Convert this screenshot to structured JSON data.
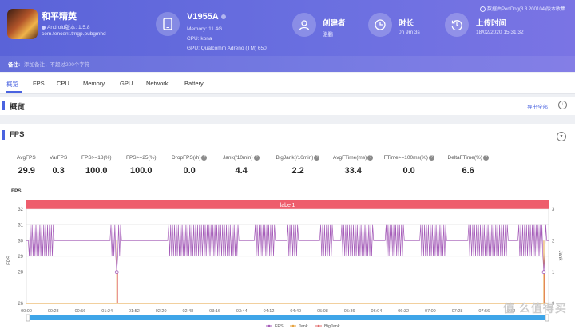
{
  "app": {
    "name": "和平精英",
    "os": "Android版本: 1.5.8",
    "package": "com.tencent.tmgp.pubgmhd"
  },
  "device": {
    "name": "V1955A",
    "memory": "Memory: 11.4G",
    "cpu": "CPU: kona",
    "gpu": "GPU: Qualcomm Adreno (TM) 650"
  },
  "creator": {
    "title": "创建者",
    "value": "骆鹏"
  },
  "duration": {
    "title": "时长",
    "value": "0h 9m 3s"
  },
  "upload": {
    "title": "上传时间",
    "value": "18/02/2020 15:31:32"
  },
  "perfdog": "数据由PerfDog(3.3.200104)版本收集",
  "note": {
    "label": "备注:",
    "placeholder": "添加备注，不超过200个字符"
  },
  "tabs": [
    "概览",
    "FPS",
    "CPU",
    "Memory",
    "GPU",
    "Network",
    "Battery"
  ],
  "overview": {
    "title": "概览",
    "export": "导出全部"
  },
  "fps_panel": {
    "title": "FPS"
  },
  "stats": [
    {
      "label": "AvgFPS",
      "value": "29.9",
      "help": false
    },
    {
      "label": "VarFPS",
      "value": "0.3",
      "help": false
    },
    {
      "label": "FPS>=18(%)",
      "value": "100.0",
      "help": false
    },
    {
      "label": "FPS>=25(%)",
      "value": "100.0",
      "help": false
    },
    {
      "label": "DropFPS(/h)",
      "value": "0.0",
      "help": true
    },
    {
      "label": "Jank(/10min)",
      "value": "4.4",
      "help": true
    },
    {
      "label": "BigJank(/10min)",
      "value": "2.2",
      "help": true
    },
    {
      "label": "AvgFTime(ms)",
      "value": "33.4",
      "help": true
    },
    {
      "label": "FTime>=100ms(%)",
      "value": "0.0",
      "help": true
    },
    {
      "label": "DeltaFTime(%)",
      "value": "6.6",
      "help": true
    }
  ],
  "watermark": "值 么值得买",
  "chart_data": {
    "type": "line",
    "title": "FPS",
    "banner": "label1",
    "ylabel": "FPS",
    "y2label": "Jank",
    "ylim": [
      26,
      32
    ],
    "y2lim": [
      0,
      3
    ],
    "yticks": [
      26,
      28,
      29,
      30,
      31,
      32
    ],
    "y2ticks": [
      0,
      1,
      2,
      3
    ],
    "xlim_seconds": [
      0,
      543
    ],
    "xticks": [
      "00:00",
      "00:28",
      "00:56",
      "01:24",
      "01:52",
      "02:20",
      "02:48",
      "03:16",
      "03:44",
      "04:12",
      "04:40",
      "05:08",
      "05:36",
      "06:04",
      "06:32",
      "07:00",
      "07:28",
      "07:56",
      "08:2"
    ],
    "series": [
      {
        "name": "FPS",
        "color": "#a45bb8",
        "baseline": 30,
        "noise_range": [
          29,
          31
        ],
        "dips": [
          {
            "time": "01:34",
            "value": 28
          },
          {
            "time": "08:58",
            "value": 28
          }
        ]
      },
      {
        "name": "Jank",
        "color": "#e6a23c",
        "baseline": 0,
        "spikes": [
          {
            "time": "01:34",
            "value": 2
          },
          {
            "time": "08:58",
            "value": 2
          }
        ]
      },
      {
        "name": "BigJank",
        "color": "#e06b6b",
        "baseline": 0,
        "spikes": [
          {
            "time": "01:34",
            "value": 1
          },
          {
            "time": "08:58",
            "value": 1
          }
        ]
      }
    ],
    "legend_position": "bottom",
    "colors": {
      "accent": "#4a63e0",
      "banner": "#ee5d6c",
      "scrollbar": "#3ea5e8"
    }
  }
}
